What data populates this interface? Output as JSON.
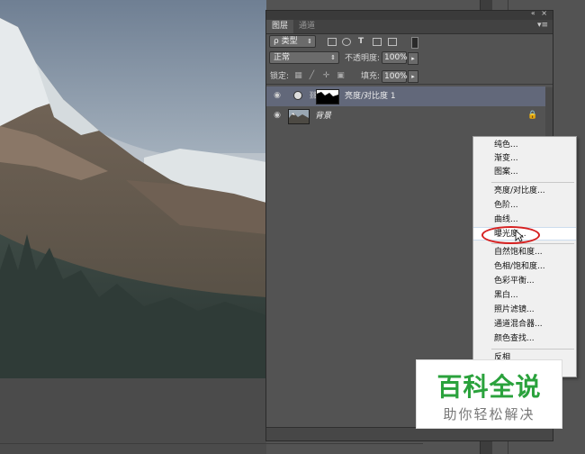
{
  "panel": {
    "tabs": [
      {
        "label": "图层",
        "active": true
      },
      {
        "label": "通道",
        "active": false
      }
    ],
    "title_buttons": "«  ×",
    "menu_icon": "▾≡",
    "filter_kind": "ρ 类型",
    "blend_mode": "正常",
    "opacity_label": "不透明度:",
    "opacity_value": "100%",
    "lock_label": "锁定:",
    "fill_label": "填充:",
    "fill_value": "100%",
    "stepper_arrow": "▸",
    "layers": [
      {
        "name": "亮度/对比度 1",
        "selected": true,
        "type": "adjustment"
      },
      {
        "name": "背景",
        "selected": false,
        "type": "image",
        "locked": true
      }
    ]
  },
  "adjustment_menu": {
    "items": [
      {
        "label": "纯色..."
      },
      {
        "label": "渐变..."
      },
      {
        "label": "图案..."
      },
      {
        "label": "亮度/对比度..."
      },
      {
        "label": "色阶..."
      },
      {
        "label": "曲线..."
      },
      {
        "label": "曝光度...",
        "highlighted": true
      },
      {
        "label": "自然饱和度..."
      },
      {
        "label": "色相/饱和度..."
      },
      {
        "label": "色彩平衡..."
      },
      {
        "label": "黑白..."
      },
      {
        "label": "照片滤镜..."
      },
      {
        "label": "通道混合器..."
      },
      {
        "label": "颜色查找..."
      },
      {
        "label": "反相"
      }
    ],
    "highlight_color": "#d62020"
  },
  "watermark": {
    "title": "百科全说",
    "subtitle": "助你轻松解决",
    "color": "#2aa23c"
  },
  "icons": {
    "eye": "eye-icon",
    "lock": "lock-icon",
    "link": "chain-link-icon"
  }
}
